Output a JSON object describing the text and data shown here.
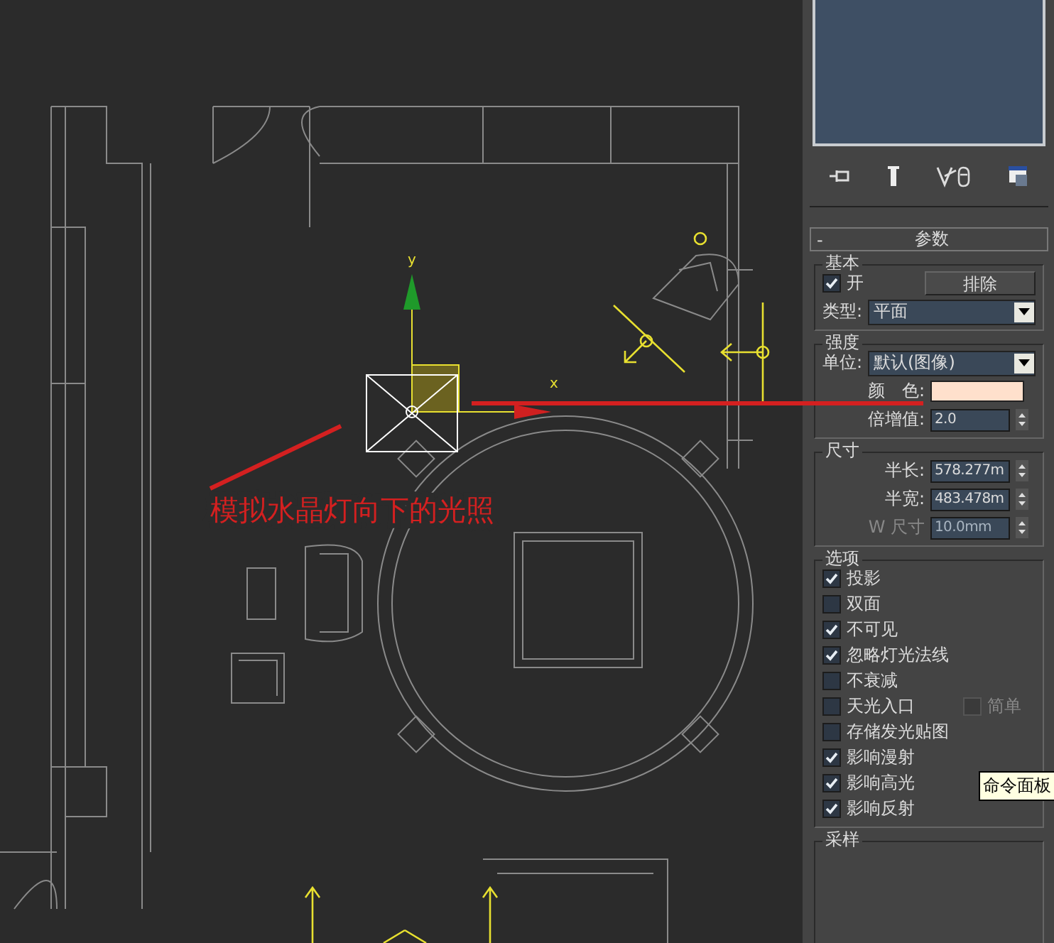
{
  "viewport": {
    "axis_labels": [
      "y",
      "x"
    ],
    "annotation": "模拟水晶灯向下的光照"
  },
  "command_panel": {
    "rollout": {
      "collapse_sign": "-",
      "title": "参数"
    },
    "basic": {
      "title": "基本",
      "on": {
        "label": "开",
        "checked": true
      },
      "exclude_button": "排除",
      "type": {
        "label": "类型:",
        "value": "平面"
      }
    },
    "intensity": {
      "title": "强度",
      "unit": {
        "label": "单位:",
        "value": "默认(图像)"
      },
      "color": {
        "label": "颜　色:",
        "color": "#ffe0cc"
      },
      "multiplier": {
        "label": "倍增值:",
        "value": "2.0"
      }
    },
    "size": {
      "title": "尺寸",
      "fields": [
        {
          "label": "半长:",
          "value": "578.277m",
          "disabled": false
        },
        {
          "label": "半宽:",
          "value": "483.478m",
          "disabled": false
        },
        {
          "label": "W 尺寸",
          "value": "10.0mm",
          "disabled": true
        }
      ]
    },
    "options": {
      "title": "选项",
      "items": [
        {
          "label": "投影",
          "checked": true
        },
        {
          "label": "双面",
          "checked": false
        },
        {
          "label": "不可见",
          "checked": true
        },
        {
          "label": "忽略灯光法线",
          "checked": true
        },
        {
          "label": "不衰减",
          "checked": false
        },
        {
          "label": "天光入口",
          "checked": false,
          "extra": {
            "label": "简单",
            "checked": false,
            "disabled": true
          }
        },
        {
          "label": "存储发光贴图",
          "checked": false
        },
        {
          "label": "影响漫射",
          "checked": true
        },
        {
          "label": "影响高光",
          "checked": true
        },
        {
          "label": "影响反射",
          "checked": true
        }
      ]
    },
    "sampling": {
      "title": "采样"
    }
  },
  "tooltip": "命令面板"
}
